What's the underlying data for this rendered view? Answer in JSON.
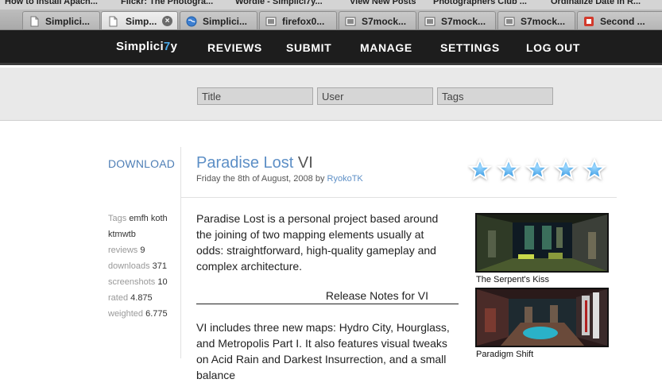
{
  "bookmarks": [
    "How to install Apach...",
    "Flickr: The Photogra...",
    "Wordle - Simplici7y...",
    "View New Posts",
    "Photographers Club ...",
    "Ordinalize Date in R..."
  ],
  "tabs": [
    {
      "label": "Simplici...",
      "icon": "page-icon",
      "active": false
    },
    {
      "label": "Simp...",
      "icon": "page-icon",
      "active": true
    },
    {
      "label": "Simplici...",
      "icon": "globe-icon",
      "active": false
    },
    {
      "label": "firefox0...",
      "icon": "image-icon",
      "active": false
    },
    {
      "label": "S7mock...",
      "icon": "image-icon",
      "active": false
    },
    {
      "label": "S7mock...",
      "icon": "image-icon",
      "active": false
    },
    {
      "label": "S7mock...",
      "icon": "image-icon",
      "active": false
    },
    {
      "label": "Second ...",
      "icon": "red-icon",
      "active": false
    }
  ],
  "site": {
    "logo_prefix": "Simplici",
    "logo_accent": "7",
    "logo_suffix": "y",
    "accent_color": "#4aa8e8",
    "nav": [
      "REVIEWS",
      "SUBMIT",
      "MANAGE",
      "SETTINGS",
      "LOG OUT"
    ]
  },
  "search": {
    "title_placeholder": "Title",
    "user_placeholder": "User",
    "tags_placeholder": "Tags"
  },
  "map": {
    "download_label": "DOWNLOAD",
    "title": "Paradise Lost",
    "version": "VI",
    "date": "Friday the 8th of August, 2008 by",
    "author": "RyokoTK",
    "rating_stars": 5,
    "meta": [
      {
        "label": "Tags",
        "value": "emfh koth"
      },
      {
        "label": "",
        "value": "ktmwtb"
      },
      {
        "label": "reviews",
        "value": "9"
      },
      {
        "label": "downloads",
        "value": "371"
      },
      {
        "label": "screenshots",
        "value": "10"
      },
      {
        "label": "rated",
        "value": "4.875"
      },
      {
        "label": "weighted",
        "value": "6.775"
      }
    ],
    "description": "Paradise Lost is a personal project based around the joining of two mapping elements usually at odds: straightforward, high-quality gameplay and complex architecture.",
    "release_notes_title": "Release Notes for VI",
    "release_text": "VI includes three new maps: Hydro City, Hourglass, and Metropolis Part I. It also features visual tweaks on Acid Rain and Darkest Insurrection, and a small balance",
    "screenshots": [
      {
        "caption": "The Serpent's Kiss"
      },
      {
        "caption": "Paradigm Shift"
      }
    ]
  }
}
